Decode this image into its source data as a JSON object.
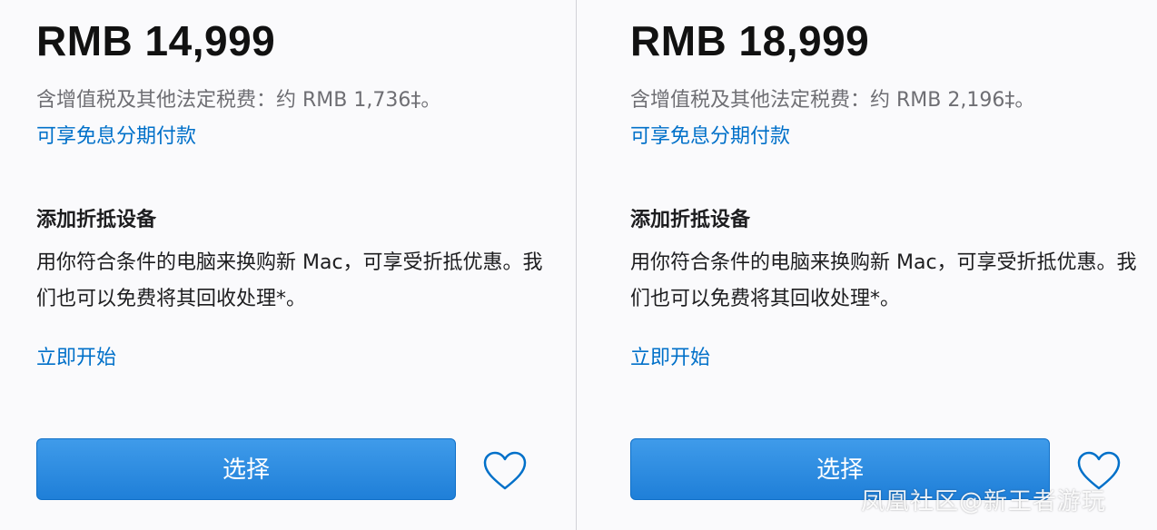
{
  "products": [
    {
      "price": "RMB 14,999",
      "tax_note": "含增值税及其他法定税费：约 RMB 1,736‡。",
      "installment_link": "可享免息分期付款",
      "tradein_title": "添加折抵设备",
      "tradein_desc": "用你符合条件的电脑来换购新 Mac，可享受折抵优惠。我们也可以免费将其回收处理*。",
      "start_link": "立即开始",
      "select_button": "选择",
      "favorite_icon": "heart-outline-icon"
    },
    {
      "price": "RMB 18,999",
      "tax_note": "含增值税及其他法定税费：约 RMB 2,196‡。",
      "installment_link": "可享免息分期付款",
      "tradein_title": "添加折抵设备",
      "tradein_desc": "用你符合条件的电脑来换购新 Mac，可享受折抵优惠。我们也可以免费将其回收处理*。",
      "start_link": "立即开始",
      "select_button": "选择",
      "favorite_icon": "heart-outline-icon"
    }
  ],
  "watermark": "凤凰社区@新王者游玩",
  "colors": {
    "link": "#0070c9",
    "button_top": "#3f9bea",
    "button_bottom": "#1f7fd8",
    "muted_text": "#6e6e73",
    "heart": "#0070c9"
  }
}
